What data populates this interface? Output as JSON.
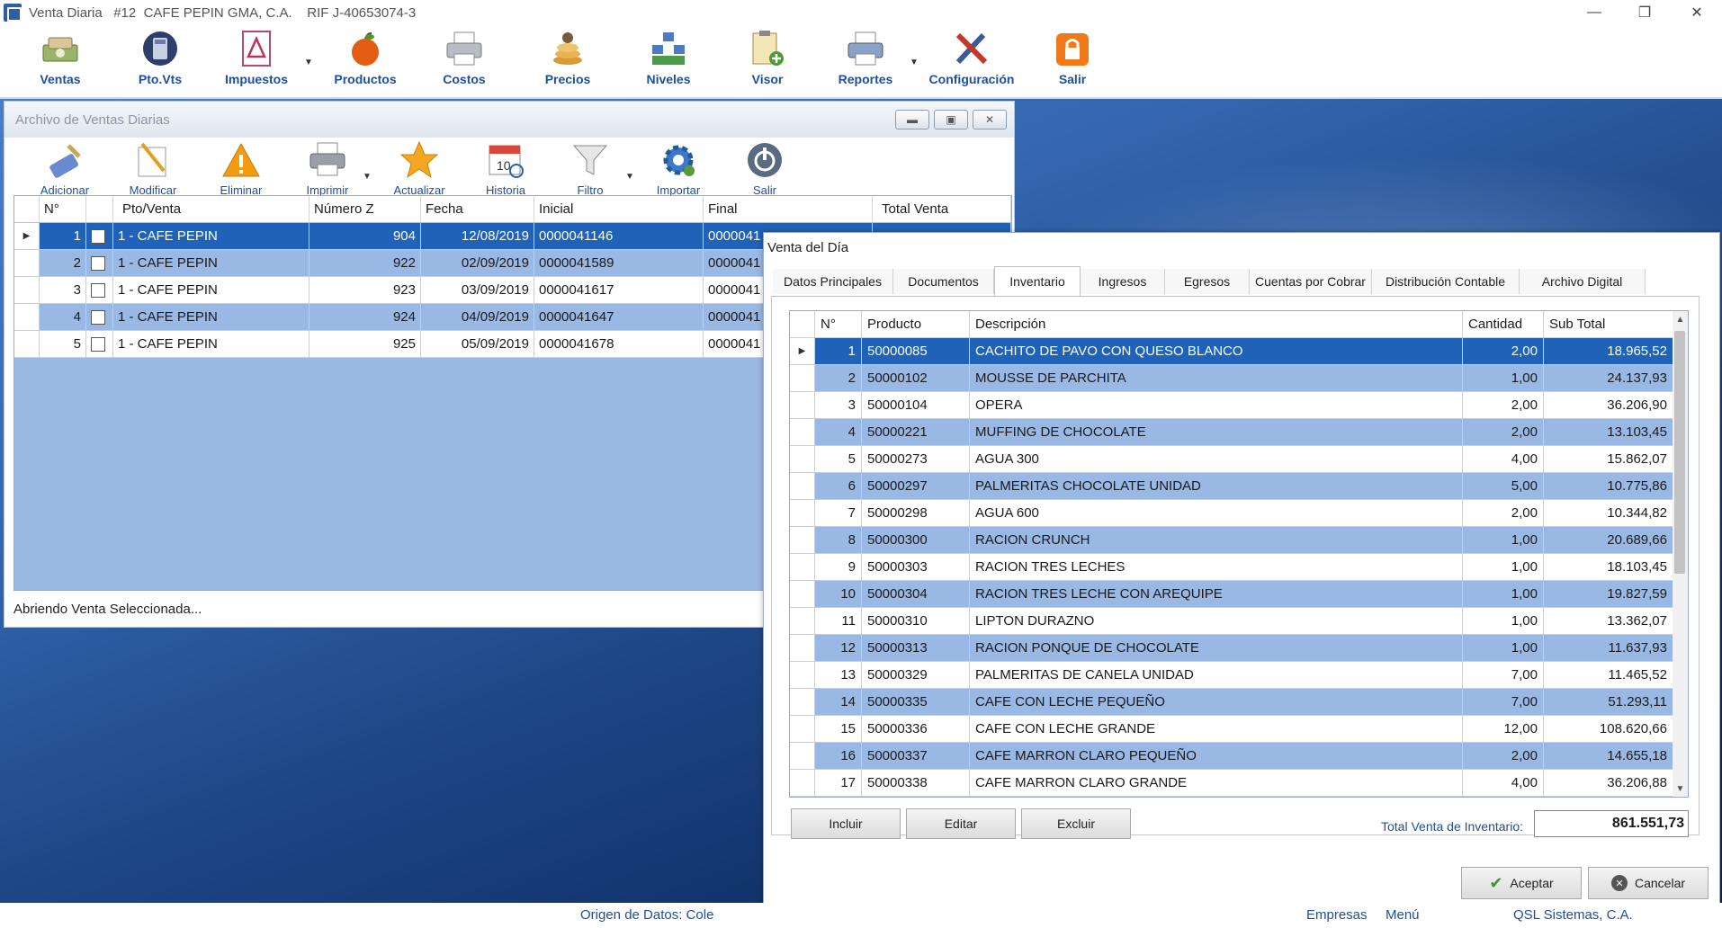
{
  "window": {
    "title": "Venta Diaria   #12  CAFE PEPIN GMA, C.A.    RIF J-40653074-3"
  },
  "main_toolbar": [
    {
      "label": "Ventas",
      "icon": "cash-icon"
    },
    {
      "label": "Pto.Vts",
      "icon": "calculator-icon"
    },
    {
      "label": "Impuestos",
      "icon": "pdf-icon"
    },
    {
      "label": "Productos",
      "icon": "apple-icon"
    },
    {
      "label": "Costos",
      "icon": "printer-icon"
    },
    {
      "label": "Precios",
      "icon": "coins-icon"
    },
    {
      "label": "Niveles",
      "icon": "hierarchy-icon"
    },
    {
      "label": "Visor",
      "icon": "clipboard-add-icon"
    },
    {
      "label": "Reportes",
      "icon": "printer-icon"
    },
    {
      "label": "Configuración",
      "icon": "tools-icon"
    },
    {
      "label": "Salir",
      "icon": "lock-icon"
    }
  ],
  "archivo": {
    "title": "Archivo de Ventas Diarias",
    "toolbar": [
      {
        "label": "Adicionar",
        "icon": "pen-add-icon"
      },
      {
        "label": "Modificar",
        "icon": "edit-doc-icon"
      },
      {
        "label": "Eliminar",
        "icon": "warning-icon"
      },
      {
        "label": "Imprimir",
        "icon": "printer-icon"
      },
      {
        "label": "Actualizar",
        "icon": "star-icon"
      },
      {
        "label": "Historia",
        "icon": "calendar-icon"
      },
      {
        "label": "Filtro",
        "icon": "funnel-icon"
      },
      {
        "label": "Importar",
        "icon": "gear-icon"
      },
      {
        "label": "Salir",
        "icon": "power-icon"
      }
    ],
    "columns": [
      "N°",
      "",
      "Pto/Venta",
      "Número Z",
      "Fecha",
      "Inicial",
      "Final",
      "Total Venta"
    ],
    "rows": [
      {
        "n": "1",
        "pto": "1 - CAFE PEPIN",
        "z": "904",
        "fecha": "12/08/2019",
        "inicial": "0000041146",
        "final": "0000041"
      },
      {
        "n": "2",
        "pto": "1 - CAFE PEPIN",
        "z": "922",
        "fecha": "02/09/2019",
        "inicial": "0000041589",
        "final": "0000041"
      },
      {
        "n": "3",
        "pto": "1 - CAFE PEPIN",
        "z": "923",
        "fecha": "03/09/2019",
        "inicial": "0000041617",
        "final": "0000041"
      },
      {
        "n": "4",
        "pto": "1 - CAFE PEPIN",
        "z": "924",
        "fecha": "04/09/2019",
        "inicial": "0000041647",
        "final": "0000041"
      },
      {
        "n": "5",
        "pto": "1 - CAFE PEPIN",
        "z": "925",
        "fecha": "05/09/2019",
        "inicial": "0000041678",
        "final": "0000041"
      }
    ],
    "status": "Abriendo Venta Seleccionada..."
  },
  "venta": {
    "title": "Venta del Día",
    "tabs": [
      "Datos Principales",
      "Documentos",
      "Inventario",
      "Ingresos",
      "Egresos",
      "Cuentas por Cobrar",
      "Distribución Contable",
      "Archivo Digital"
    ],
    "active_tab": "Inventario",
    "columns": [
      "N°",
      "Producto",
      "Descripción",
      "Cantidad",
      "Sub Total"
    ],
    "rows": [
      {
        "n": "1",
        "prod": "50000085",
        "desc": "CACHITO DE PAVO CON QUESO BLANCO",
        "cant": "2,00",
        "sub": "18.965,52"
      },
      {
        "n": "2",
        "prod": "50000102",
        "desc": "MOUSSE DE PARCHITA",
        "cant": "1,00",
        "sub": "24.137,93"
      },
      {
        "n": "3",
        "prod": "50000104",
        "desc": "OPERA",
        "cant": "2,00",
        "sub": "36.206,90"
      },
      {
        "n": "4",
        "prod": "50000221",
        "desc": "MUFFING DE CHOCOLATE",
        "cant": "2,00",
        "sub": "13.103,45"
      },
      {
        "n": "5",
        "prod": "50000273",
        "desc": "AGUA 300",
        "cant": "4,00",
        "sub": "15.862,07"
      },
      {
        "n": "6",
        "prod": "50000297",
        "desc": "PALMERITAS CHOCOLATE UNIDAD",
        "cant": "5,00",
        "sub": "10.775,86"
      },
      {
        "n": "7",
        "prod": "50000298",
        "desc": "AGUA 600",
        "cant": "2,00",
        "sub": "10.344,82"
      },
      {
        "n": "8",
        "prod": "50000300",
        "desc": "RACION CRUNCH",
        "cant": "1,00",
        "sub": "20.689,66"
      },
      {
        "n": "9",
        "prod": "50000303",
        "desc": "RACION TRES LECHES",
        "cant": "1,00",
        "sub": "18.103,45"
      },
      {
        "n": "10",
        "prod": "50000304",
        "desc": "RACION TRES LECHE CON AREQUIPE",
        "cant": "1,00",
        "sub": "19.827,59"
      },
      {
        "n": "11",
        "prod": "50000310",
        "desc": "LIPTON DURAZNO",
        "cant": "1,00",
        "sub": "13.362,07"
      },
      {
        "n": "12",
        "prod": "50000313",
        "desc": "RACION PONQUE DE CHOCOLATE",
        "cant": "1,00",
        "sub": "11.637,93"
      },
      {
        "n": "13",
        "prod": "50000329",
        "desc": "PALMERITAS DE CANELA UNIDAD",
        "cant": "7,00",
        "sub": "11.465,52"
      },
      {
        "n": "14",
        "prod": "50000335",
        "desc": "CAFE CON LECHE PEQUEÑO",
        "cant": "7,00",
        "sub": "51.293,11"
      },
      {
        "n": "15",
        "prod": "50000336",
        "desc": "CAFE CON LECHE GRANDE",
        "cant": "12,00",
        "sub": "108.620,66"
      },
      {
        "n": "16",
        "prod": "50000337",
        "desc": "CAFE MARRON CLARO PEQUEÑO",
        "cant": "2,00",
        "sub": "14.655,18"
      },
      {
        "n": "17",
        "prod": "50000338",
        "desc": "CAFE MARRON CLARO GRANDE",
        "cant": "4,00",
        "sub": "36.206,88"
      }
    ],
    "buttons": {
      "incluir": "Incluir",
      "editar": "Editar",
      "excluir": "Excluir",
      "aceptar": "Aceptar",
      "cancelar": "Cancelar"
    },
    "total_label": "Total Venta de Inventario:",
    "total_value": "861.551,73"
  },
  "statusbar": {
    "origen": "Origen de Datos: Cole",
    "empresas": "Empresas",
    "menu": "Menú",
    "company": "QSL Sistemas, C.A."
  },
  "colors": {
    "selected_row": "#1f62b8",
    "alt_row": "#9ab8e4",
    "label_blue": "#1f4e9c"
  }
}
